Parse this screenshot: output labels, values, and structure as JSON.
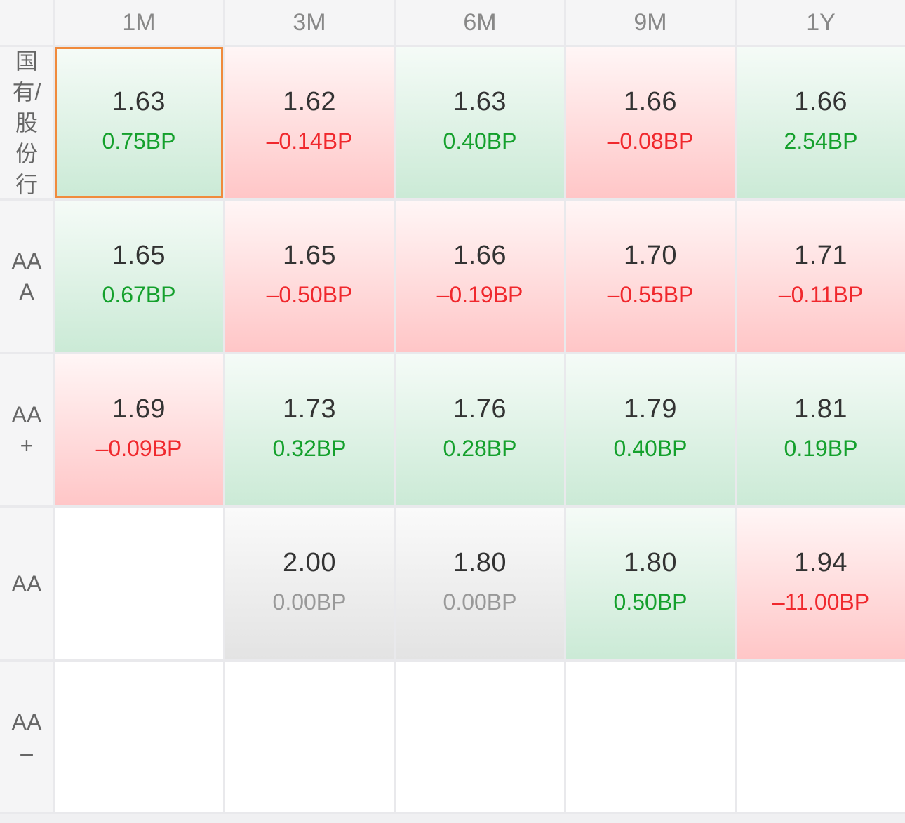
{
  "columns": [
    "1M",
    "3M",
    "6M",
    "9M",
    "1Y"
  ],
  "rows": [
    {
      "label": "国有/股份行",
      "cells": [
        {
          "rate": "1.63",
          "change": "0.75BP",
          "trend": "up",
          "selected": true
        },
        {
          "rate": "1.62",
          "change": "–0.14BP",
          "trend": "down"
        },
        {
          "rate": "1.63",
          "change": "0.40BP",
          "trend": "up"
        },
        {
          "rate": "1.66",
          "change": "–0.08BP",
          "trend": "down"
        },
        {
          "rate": "1.66",
          "change": "2.54BP",
          "trend": "up"
        }
      ]
    },
    {
      "label": "AAA",
      "cells": [
        {
          "rate": "1.65",
          "change": "0.67BP",
          "trend": "up"
        },
        {
          "rate": "1.65",
          "change": "–0.50BP",
          "trend": "down"
        },
        {
          "rate": "1.66",
          "change": "–0.19BP",
          "trend": "down"
        },
        {
          "rate": "1.70",
          "change": "–0.55BP",
          "trend": "down"
        },
        {
          "rate": "1.71",
          "change": "–0.11BP",
          "trend": "down"
        }
      ]
    },
    {
      "label": "AA+",
      "cells": [
        {
          "rate": "1.69",
          "change": "–0.09BP",
          "trend": "down"
        },
        {
          "rate": "1.73",
          "change": "0.32BP",
          "trend": "up"
        },
        {
          "rate": "1.76",
          "change": "0.28BP",
          "trend": "up"
        },
        {
          "rate": "1.79",
          "change": "0.40BP",
          "trend": "up"
        },
        {
          "rate": "1.81",
          "change": "0.19BP",
          "trend": "up"
        }
      ]
    },
    {
      "label": "AA",
      "cells": [
        {
          "rate": "",
          "change": "",
          "trend": "empty"
        },
        {
          "rate": "2.00",
          "change": "0.00BP",
          "trend": "flat"
        },
        {
          "rate": "1.80",
          "change": "0.00BP",
          "trend": "flat"
        },
        {
          "rate": "1.80",
          "change": "0.50BP",
          "trend": "up"
        },
        {
          "rate": "1.94",
          "change": "–11.00BP",
          "trend": "down"
        }
      ]
    },
    {
      "label": "AA–",
      "cells": [
        {
          "rate": "",
          "change": "",
          "trend": "empty"
        },
        {
          "rate": "",
          "change": "",
          "trend": "empty"
        },
        {
          "rate": "",
          "change": "",
          "trend": "empty"
        },
        {
          "rate": "",
          "change": "",
          "trend": "empty"
        },
        {
          "rate": "",
          "change": "",
          "trend": "empty"
        }
      ]
    }
  ],
  "colors": {
    "up": "#14a02c",
    "down": "#f0282d",
    "flat": "#999999",
    "selected_border": "#f08a3c"
  }
}
